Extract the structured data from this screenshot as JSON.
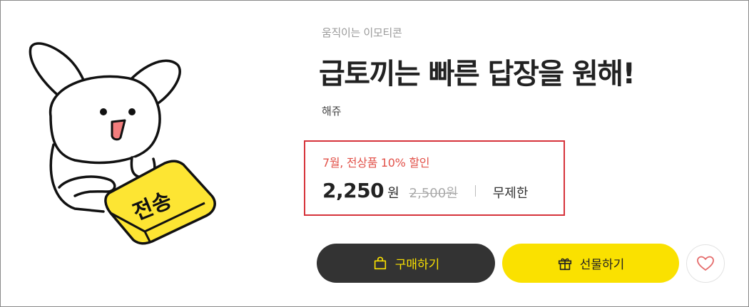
{
  "product": {
    "category": "움직이는 이모티콘",
    "title": "급토끼는 빠른 답장을 원해!",
    "author": "해쥬",
    "illustration_text": "전송"
  },
  "pricing": {
    "promo": "7월, 전상품 10% 할인",
    "price": "2,250",
    "unit": "원",
    "original_price": "2,500원",
    "period": "무제한",
    "box_border_color": "#d6333b",
    "promo_color": "#e2524a"
  },
  "actions": {
    "buy_label": "구매하기",
    "gift_label": "선물하기",
    "buy_bg": "#333333",
    "buy_fg": "#fae100",
    "gift_bg": "#fae100",
    "icons": {
      "buy": "shopping-bag-icon",
      "gift": "gift-icon",
      "like": "heart-icon"
    }
  }
}
